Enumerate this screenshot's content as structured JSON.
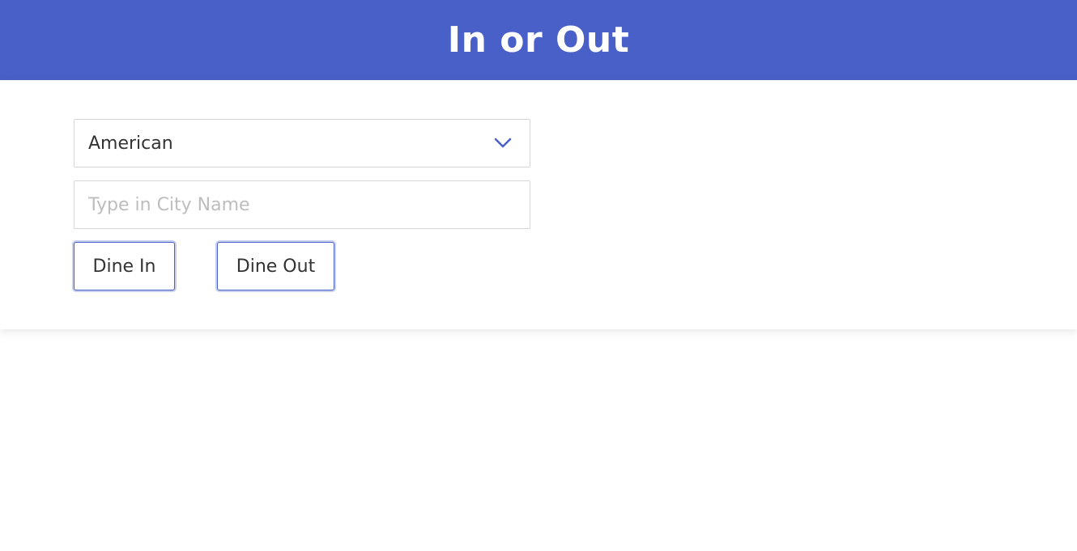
{
  "header": {
    "title": "In or Out"
  },
  "form": {
    "cuisine_select": {
      "selected": "American"
    },
    "city_input": {
      "value": "",
      "placeholder": "Type in City Name"
    },
    "dine_in_label": "Dine In",
    "dine_out_label": "Dine Out"
  },
  "colors": {
    "accent": "#4960c9",
    "header_text": "#ffffff",
    "border": "#d6d6d6",
    "placeholder": "#bdbdbd"
  },
  "icons": {
    "select_arrow": "chevron-down-icon"
  }
}
